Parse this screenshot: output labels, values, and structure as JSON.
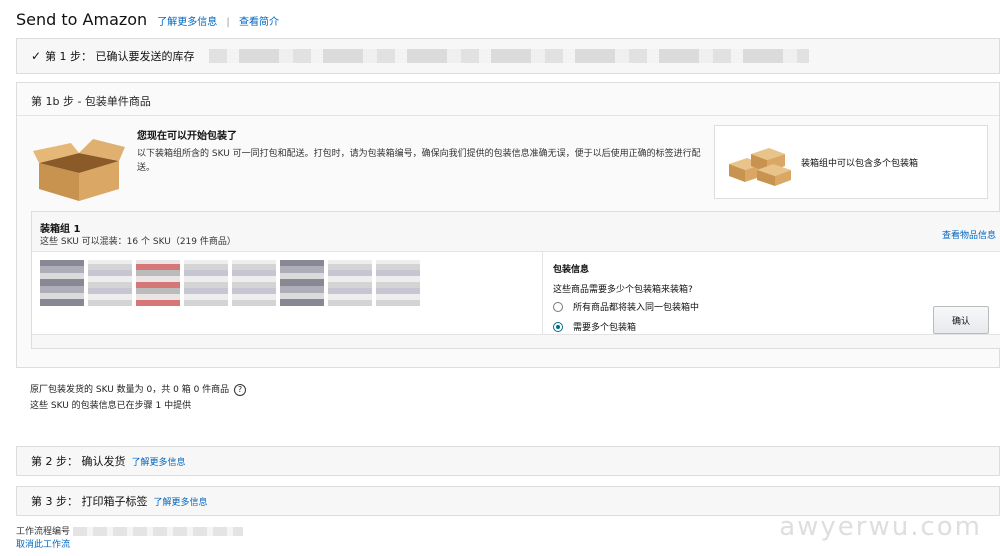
{
  "header": {
    "title": "Send to Amazon",
    "learn_more": "了解更多信息",
    "separator": "|",
    "view_intro": "查看简介"
  },
  "step1": {
    "label": "第 1 步：  已确认要发送的库存"
  },
  "step1b": {
    "title": "第 1b 步 - 包装单件商品",
    "intro_heading": "您现在可以开始包装了",
    "intro_text": "以下装箱组所含的 SKU 可一同打包和配送。打包时，请为包装箱编号，确保向我们提供的包装信息准确无误，便于以后使用正确的标签进行配送。",
    "multi_box_text": "装箱组中可以包含多个包装箱",
    "pack_group": {
      "name": "装箱组 1",
      "summary": "这些 SKU 可以混装：16 个 SKU（219 件商品）",
      "view_items": "查看物品信息",
      "pack_info_title": "包装信息",
      "question": "这些商品需要多少个包装箱来装箱?",
      "option_single": "所有商品都将装入同一包装箱中",
      "option_multiple": "需要多个包装箱",
      "selected_option": "option_multiple",
      "confirm": "确认"
    },
    "oem_line1": "原厂包装发货的 SKU 数量为 0，共 0 箱 0 件商品",
    "oem_line2": "这些 SKU 的包装信息已在步骤 1 中提供",
    "help_icon": "?"
  },
  "step2": {
    "label": "第 2 步：  确认发货",
    "learn_more": "了解更多信息"
  },
  "step3": {
    "label": "第 3 步：  打印箱子标签",
    "learn_more": "了解更多信息"
  },
  "footer": {
    "workflow_id": "工作流程编号",
    "cancel_workflow": "取消此工作流"
  },
  "watermark": "awyerwu.com",
  "colors": {
    "link": "#0066c0",
    "radio_selected": "#007185",
    "panel_bg": "#f7f7f7"
  }
}
